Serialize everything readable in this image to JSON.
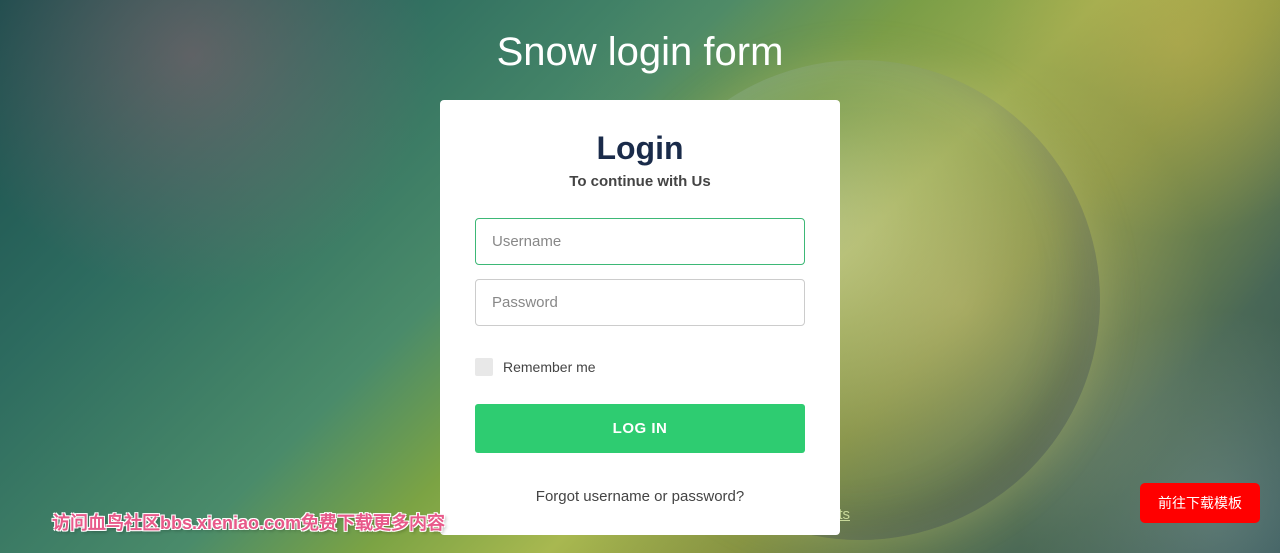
{
  "page": {
    "title": "Snow login form"
  },
  "card": {
    "heading": "Login",
    "subtitle": "To continue with Us"
  },
  "form": {
    "username_placeholder": "Username",
    "password_placeholder": "Password",
    "remember_label": "Remember me",
    "submit_label": "LOG IN",
    "forgot_text": "Forgot username or password?"
  },
  "footer": {
    "watermark_text": "访问血鸟社区bbs.xieniao.com免费下载更多内容",
    "side_link_text": "ts",
    "download_button_label": "前往下载模板"
  }
}
